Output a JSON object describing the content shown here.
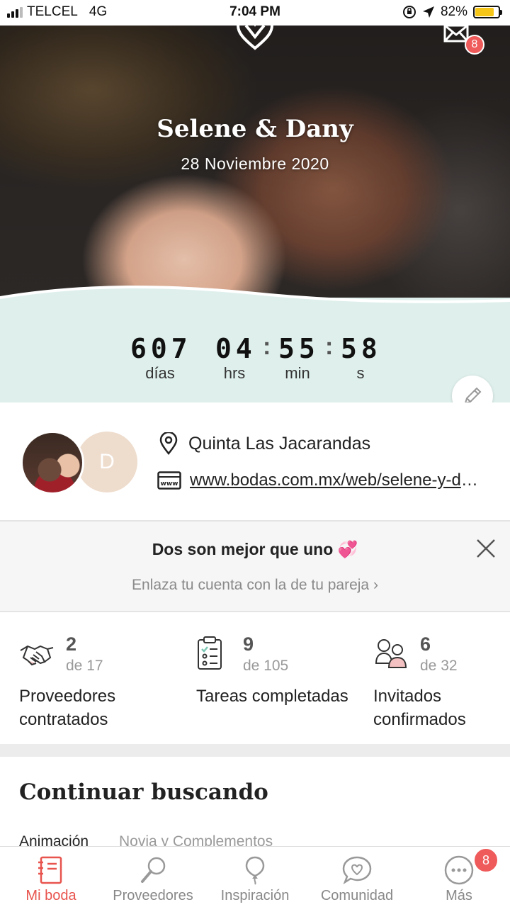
{
  "status_bar": {
    "carrier": "TELCEL",
    "network": "4G",
    "time": "7:04 PM",
    "battery_percent": "82%",
    "battery_level": 0.82
  },
  "hero": {
    "couple_names": "Selene & Dany",
    "wedding_date": "28 Noviembre 2020",
    "mail_badge": "8"
  },
  "countdown": {
    "days": "607",
    "hours": "04",
    "minutes": "55",
    "seconds": "58",
    "days_label": "días",
    "hours_label": "hrs",
    "minutes_label": "min",
    "seconds_label": "s"
  },
  "info": {
    "partner_initial": "D",
    "venue": "Quinta Las Jacarandas",
    "website": "www.bodas.com.mx/web/selene-y-dany"
  },
  "partner_banner": {
    "title": "Dos son mejor que uno 💞",
    "link": "Enlaza tu cuenta con la de tu pareja ›"
  },
  "stats": [
    {
      "count": "2",
      "total": "de 17",
      "label": "Proveedores contratados",
      "icon": "handshake-icon"
    },
    {
      "count": "9",
      "total": "de 105",
      "label": "Tareas completadas",
      "icon": "checklist-icon"
    },
    {
      "count": "6",
      "total": "de 32",
      "label": "Invitados confirmados",
      "icon": "guests-icon"
    }
  ],
  "continue": {
    "title": "Continuar buscando",
    "chips": [
      "Animación",
      "Novia y Complementos"
    ]
  },
  "bottom_nav": {
    "items": [
      {
        "label": "Mi boda",
        "icon": "notebook-icon",
        "active": true
      },
      {
        "label": "Proveedores",
        "icon": "magnifier-icon",
        "active": false
      },
      {
        "label": "Inspiración",
        "icon": "balloon-icon",
        "active": false
      },
      {
        "label": "Comunidad",
        "icon": "chat-heart-icon",
        "active": false
      },
      {
        "label": "Más",
        "icon": "more-icon",
        "active": false
      }
    ],
    "more_badge": "8"
  },
  "colors": {
    "accent": "#e8544e",
    "countdown_bg": "#dff0ec",
    "badge": "#ef5a5a"
  }
}
